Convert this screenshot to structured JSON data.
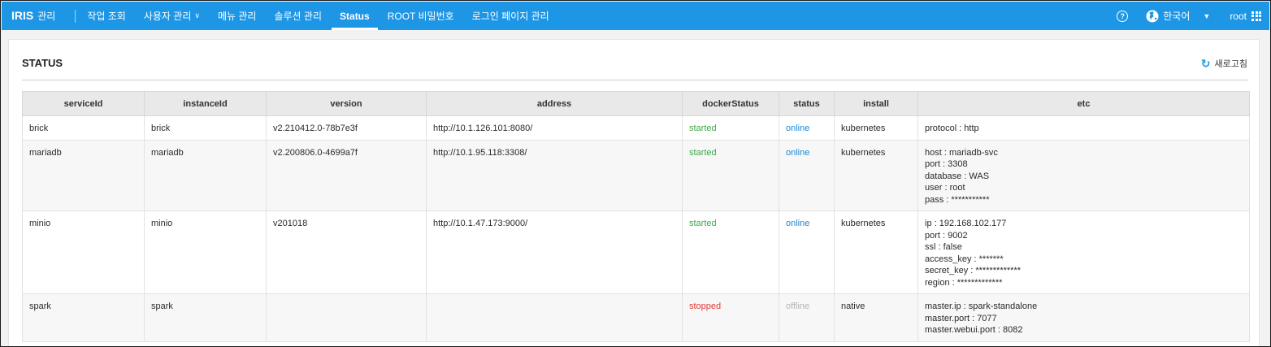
{
  "nav": {
    "brand": "IRIS",
    "brand_sub": "관리",
    "items": [
      {
        "label": "작업 조회",
        "caret": false,
        "active": false
      },
      {
        "label": "사용자 관리",
        "caret": true,
        "active": false
      },
      {
        "label": "메뉴 관리",
        "caret": false,
        "active": false
      },
      {
        "label": "솔루션 관리",
        "caret": false,
        "active": false
      },
      {
        "label": "Status",
        "caret": false,
        "active": true
      },
      {
        "label": "ROOT 비밀번호",
        "caret": false,
        "active": false
      },
      {
        "label": "로그인 페이지 관리",
        "caret": false,
        "active": false
      }
    ],
    "help": "?",
    "language": "한국어",
    "user": "root"
  },
  "page": {
    "title": "STATUS",
    "refresh_label": "새로고침"
  },
  "colors": {
    "nav_bg": "#1e96e6",
    "started": "#3eaa4a",
    "stopped": "#e53935",
    "online": "#1e88d6",
    "offline": "#b5b5b5"
  },
  "table": {
    "columns": [
      "serviceId",
      "instanceId",
      "version",
      "address",
      "dockerStatus",
      "status",
      "install",
      "etc"
    ],
    "rows": [
      {
        "serviceId": "brick",
        "instanceId": "brick",
        "version": "v2.210412.0-78b7e3f",
        "address": "http://10.1.126.101:8080/",
        "dockerStatus": "started",
        "status": "online",
        "install": "kubernetes",
        "etc": [
          "protocol : http"
        ]
      },
      {
        "serviceId": "mariadb",
        "instanceId": "mariadb",
        "version": "v2.200806.0-4699a7f",
        "address": "http://10.1.95.118:3308/",
        "dockerStatus": "started",
        "status": "online",
        "install": "kubernetes",
        "etc": [
          "host : mariadb-svc",
          "port : 3308",
          "database : WAS",
          "user : root",
          "pass : ***********"
        ]
      },
      {
        "serviceId": "minio",
        "instanceId": "minio",
        "version": "v201018",
        "address": "http://10.1.47.173:9000/",
        "dockerStatus": "started",
        "status": "online",
        "install": "kubernetes",
        "etc": [
          "ip : 192.168.102.177",
          "port : 9002",
          "ssl : false",
          "access_key : *******",
          "secret_key : *************",
          "region : *************"
        ]
      },
      {
        "serviceId": "spark",
        "instanceId": "spark",
        "version": "",
        "address": "",
        "dockerStatus": "stopped",
        "status": "offline",
        "install": "native",
        "etc": [
          "master.ip : spark-standalone",
          "master.port : 7077",
          "master.webui.port : 8082"
        ]
      }
    ]
  }
}
